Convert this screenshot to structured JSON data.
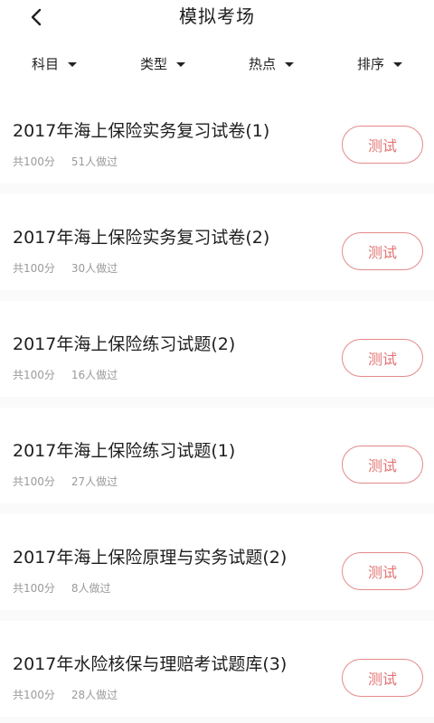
{
  "header": {
    "title": "模拟考场",
    "back_icon": "chevron-left-icon"
  },
  "filters": [
    {
      "label": "科目",
      "icon": "caret-down-icon"
    },
    {
      "label": "类型",
      "icon": "caret-down-icon"
    },
    {
      "label": "热点",
      "icon": "caret-down-icon"
    },
    {
      "label": "排序",
      "icon": "caret-down-icon"
    }
  ],
  "items": [
    {
      "title": "2017年海上保险实务复习试卷(1)",
      "score": "共100分",
      "taken": "51人做过",
      "button": "测试"
    },
    {
      "title": "2017年海上保险实务复习试卷(2)",
      "score": "共100分",
      "taken": "30人做过",
      "button": "测试"
    },
    {
      "title": "2017年海上保险练习试题(2)",
      "score": "共100分",
      "taken": "16人做过",
      "button": "测试"
    },
    {
      "title": "2017年海上保险练习试题(1)",
      "score": "共100分",
      "taken": "27人做过",
      "button": "测试"
    },
    {
      "title": "2017年海上保险原理与实务试题(2)",
      "score": "共100分",
      "taken": "8人做过",
      "button": "测试"
    },
    {
      "title": "2017年水险核保与理赔考试题库(3)",
      "score": "共100分",
      "taken": "28人做过",
      "button": "测试"
    }
  ],
  "colors": {
    "accent": "#e47474",
    "accent_border": "#e48a8a",
    "text_primary": "#1e1e1e",
    "text_secondary": "#9a9a9a"
  }
}
